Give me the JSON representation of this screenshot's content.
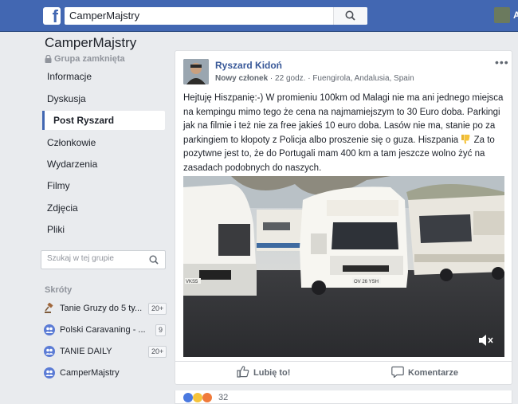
{
  "topbar": {
    "logo": "f",
    "search_value": "CamperMajstry",
    "search_icon": "search-icon",
    "profile_initial": "A"
  },
  "group": {
    "name": "CamperMajstry",
    "type": "Grupa zamknięta",
    "nav": [
      {
        "label": "Informacje",
        "active": false
      },
      {
        "label": "Dyskusja",
        "active": false
      },
      {
        "label": "Post Ryszard",
        "active": true
      },
      {
        "label": "Członkowie",
        "active": false
      },
      {
        "label": "Wydarzenia",
        "active": false
      },
      {
        "label": "Filmy",
        "active": false
      },
      {
        "label": "Zdjęcia",
        "active": false
      },
      {
        "label": "Pliki",
        "active": false
      }
    ],
    "search_placeholder": "Szukaj w tej grupie"
  },
  "shortcuts": {
    "title": "Skróty",
    "items": [
      {
        "label": "Tanie Gruzy do 5 ty...",
        "badge": "20+",
        "icon": "gavel-icon"
      },
      {
        "label": "Polski Caravaning - ...",
        "badge": "9",
        "icon": "group-icon"
      },
      {
        "label": "TANIE DAILY",
        "badge": "20+",
        "icon": "group-icon"
      },
      {
        "label": "CamperMajstry",
        "badge": "",
        "icon": "group-icon"
      }
    ]
  },
  "post": {
    "author": "Ryszard Kidoń",
    "badge": "Nowy członek",
    "time": "22 godz.",
    "location": "Fuengirola, Andalusia, Spain",
    "separator": "·",
    "text_part1": "Hejtuję Hiszpanię:-) W promieniu 100km od Malagi nie ma ani jednego miejsca na kempingu mimo tego że cena na najmamiejszym to 30 Euro doba. Parkingi jak na filmie i też nie za free jakieś 10 euro doba. Lasów nie ma, stanie po za parkingiem to kłopoty z Policja albo proszenie się o guza. Hiszpania",
    "text_part2": "Za to pozytwne jest to, że do Portugali mam 400 km a tam jeszcze wolno żyć na zasadach podobnych do naszych.",
    "emoji": "thumbs-down-emoji",
    "plate_left": "VKS5",
    "plate_center": "OV 26 YSH",
    "like_label": "Lubię to!",
    "comment_label": "Komentarze",
    "reaction_count": "32",
    "more": "•••"
  },
  "colors": {
    "brand": "#4267b2",
    "link": "#385898",
    "background": "#e9ebee"
  }
}
